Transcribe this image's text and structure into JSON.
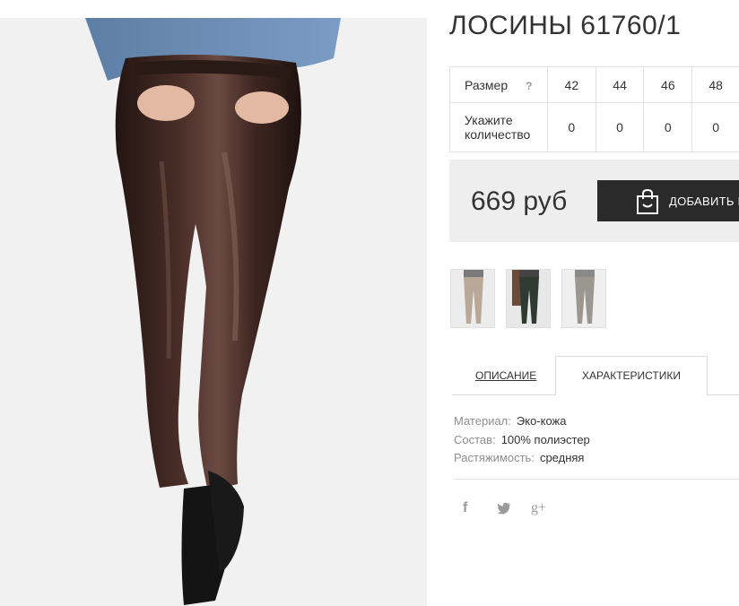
{
  "product": {
    "title": "ЛОСИНЫ 61760/1"
  },
  "sizes": {
    "row_label": "Размер",
    "help_icon": "?",
    "qty_label": "Укажите количество",
    "items": [
      {
        "size": "42",
        "qty": "0"
      },
      {
        "size": "44",
        "qty": "0"
      },
      {
        "size": "46",
        "qty": "0"
      },
      {
        "size": "48",
        "qty": "0"
      }
    ]
  },
  "buy": {
    "price": "669 руб",
    "add_label": "ДОБАВИТЬ В КОРЗИНУ",
    "icon": "shopping-bag-icon"
  },
  "thumbnails": [
    {
      "name": "thumbnail-beige-leggings",
      "color": "#b8a898"
    },
    {
      "name": "thumbnail-green-leggings",
      "color": "#2f3a32"
    },
    {
      "name": "thumbnail-grey-leggings",
      "color": "#9b968f"
    }
  ],
  "tabs": {
    "description": "ОПИСАНИЕ",
    "characteristics": "ХАРАКТЕРИСТИКИ",
    "active": "characteristics"
  },
  "specs": [
    {
      "key": "Материал:",
      "value": "Эко-кожа"
    },
    {
      "key": "Состав:",
      "value": "100% полиэстер"
    },
    {
      "key": "Растяжимость:",
      "value": "средняя"
    }
  ],
  "social": {
    "facebook": "f",
    "twitter": "twitter-icon",
    "googleplus": "g+"
  },
  "colors": {
    "button_bg": "#2a2a2a",
    "buy_box_bg": "#eeeeee",
    "leggings": "#3a2420",
    "sweater": "#6b8fb8"
  }
}
